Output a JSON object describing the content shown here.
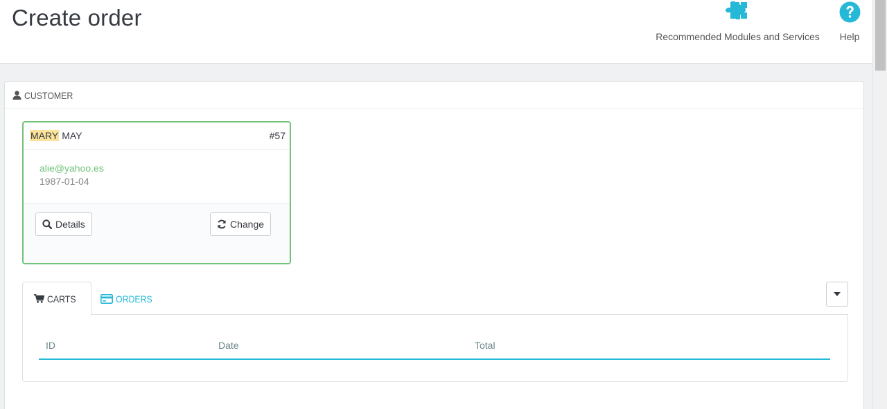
{
  "header": {
    "title": "Create order",
    "toolbar": [
      {
        "label": "Recommended Modules and Services",
        "icon": "puzzle-icon"
      },
      {
        "label": "Help",
        "icon": "help-icon"
      }
    ]
  },
  "customer_panel": {
    "heading": "CUSTOMER",
    "card": {
      "first_name": "MARY",
      "last_name": "MAY",
      "id": "#57",
      "email": "alie@yahoo.es",
      "birthdate": "1987-01-04",
      "details_label": "Details",
      "change_label": "Change"
    }
  },
  "tabs": [
    {
      "label": "CARTS",
      "active": true
    },
    {
      "label": "ORDERS",
      "active": false
    }
  ],
  "table": {
    "columns": [
      "ID",
      "Date",
      "Total"
    ]
  },
  "colors": {
    "accent": "#25b9d7",
    "success": "#72c279",
    "highlight": "#fbe39a"
  }
}
